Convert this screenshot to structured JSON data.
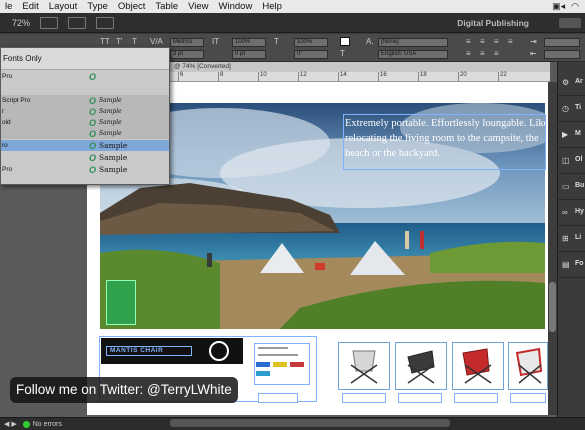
{
  "menubar": {
    "items": [
      "le",
      "Edit",
      "Layout",
      "Type",
      "Object",
      "Table",
      "View",
      "Window",
      "Help"
    ]
  },
  "appbar": {
    "zoom": "72%",
    "workspace": "Digital Publishing"
  },
  "control": {
    "tracking": "Metrics",
    "scale_v": "100%",
    "scale_h": "100%",
    "baseline": "0 pt",
    "skew": "0°",
    "leading": "3 pt",
    "char_style": "[None]",
    "language": "English: USA"
  },
  "font_menu": {
    "header": "Fonts Only",
    "rows": [
      {
        "name": "Pro",
        "sample": ""
      },
      {
        "name": "Script Pro",
        "sample": "Sample"
      },
      {
        "name": "r",
        "sample": "Sample"
      },
      {
        "name": "old",
        "sample": "Sample"
      },
      {
        "name": "",
        "sample": "Sample"
      },
      {
        "name": "ro",
        "sample": "Sample"
      },
      {
        "name": "",
        "sample": "Sample"
      },
      {
        "name": "Pro",
        "sample": "Sample"
      }
    ]
  },
  "document": {
    "tab_title": "@ 74% [Converted]",
    "ruler_ticks": [
      "6",
      "8",
      "10",
      "12",
      "14",
      "16",
      "18",
      "20",
      "22"
    ],
    "photo_text": "Extremely portable. Effortlessly loungable. Like relocating the living room to the campsite, the beach or the backyard.",
    "product_title": "MANTIS CHAIR"
  },
  "watermark": "Follow me on Twitter: @TerryLWhite",
  "statusbar": {
    "status": "No errors"
  },
  "right_panel": {
    "items": [
      {
        "icon": "arrange-icon",
        "label": "Ar"
      },
      {
        "icon": "timing-icon",
        "label": "Ti"
      },
      {
        "icon": "media-icon",
        "label": "M"
      },
      {
        "icon": "object-states-icon",
        "label": "Ol"
      },
      {
        "icon": "buttons-icon",
        "label": "Bu"
      },
      {
        "icon": "hyperlinks-icon",
        "label": "Hy"
      },
      {
        "icon": "liquid-layout-icon",
        "label": "Li"
      },
      {
        "icon": "folio-icon",
        "label": "Fo"
      }
    ]
  },
  "colors": {
    "accent": "#7fb3ff",
    "green": "#30a24b",
    "selection": "#7fa8d8"
  }
}
